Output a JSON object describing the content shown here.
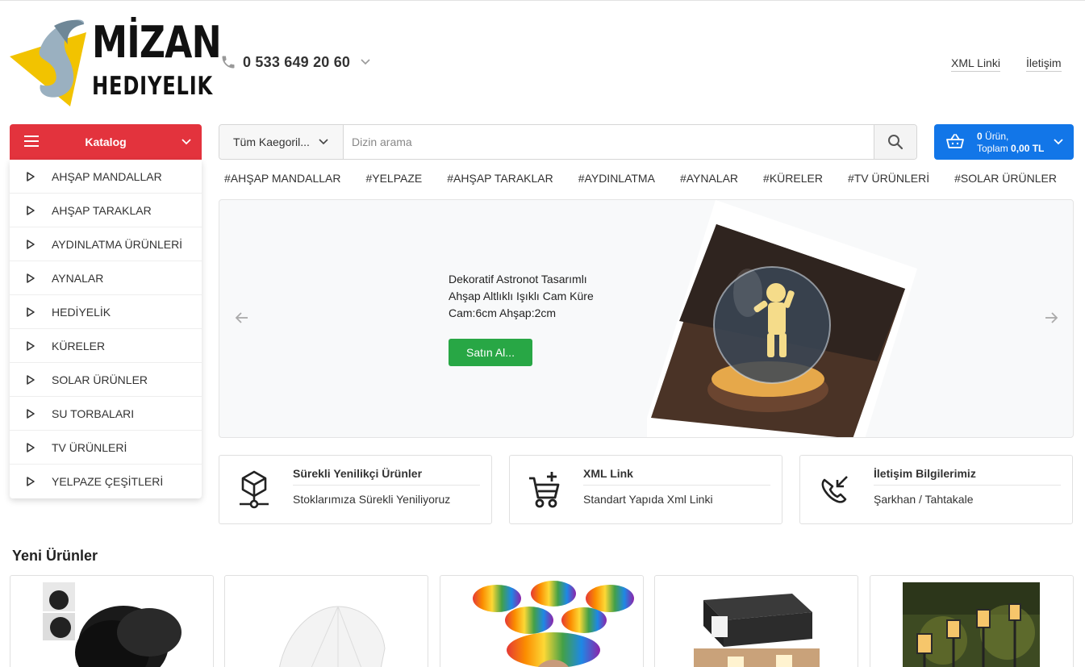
{
  "header": {
    "logo_line1": "MİZAN",
    "logo_line2": "HEDIYELIK",
    "phone": "0 533 649 20 60",
    "links": {
      "xml": "XML Linki",
      "contact": "İletişim"
    }
  },
  "catalog": {
    "label": "Katalog",
    "items": [
      "AHŞAP MANDALLAR",
      "AHŞAP TARAKLAR",
      "AYDINLATMA ÜRÜNLERİ",
      "AYNALAR",
      "HEDİYELİK",
      "KÜRELER",
      "SOLAR ÜRÜNLER",
      "SU TORBALARI",
      "TV ÜRÜNLERİ",
      "YELPAZE ÇEŞİTLERİ"
    ]
  },
  "search": {
    "category": "Tüm Kaegoril...",
    "placeholder": "Dizin arama"
  },
  "cart": {
    "count": "0",
    "count_suffix": " Ürün,",
    "total_label": "Toplam ",
    "total": "0,00 TL"
  },
  "tags": [
    "#AHŞAP MANDALLAR",
    "#YELPAZE",
    "#AHŞAP TARAKLAR",
    "#AYDINLATMA",
    "#AYNALAR",
    "#KÜRELER",
    "#TV ÜRÜNLERİ",
    "#SOLAR ÜRÜNLER"
  ],
  "slider": {
    "line1": "Dekoratif Astronot Tasarımlı",
    "line2": "Ahşap Altlıklı Işıklı Cam Küre",
    "line3": "Cam:6cm Ahşap:2cm",
    "button": "Satın Al..."
  },
  "features": [
    {
      "title": "Sürekli Yenilikçi Ürünler",
      "desc": "Stoklarımıza Sürekli Yeniliyoruz",
      "icon": "cube-network-icon"
    },
    {
      "title": "XML Link",
      "desc": "Standart Yapıda Xml Linki",
      "icon": "cart-plus-icon"
    },
    {
      "title": "İletişim Bilgilerimiz",
      "desc": "Şarkhan / Tahtakale",
      "icon": "phone-incoming-icon"
    }
  ],
  "new_products": {
    "title": "Yeni Ürünler"
  },
  "colors": {
    "catalog_red": "#e3333d",
    "cart_blue": "#1276e8",
    "buy_green": "#28a745"
  }
}
